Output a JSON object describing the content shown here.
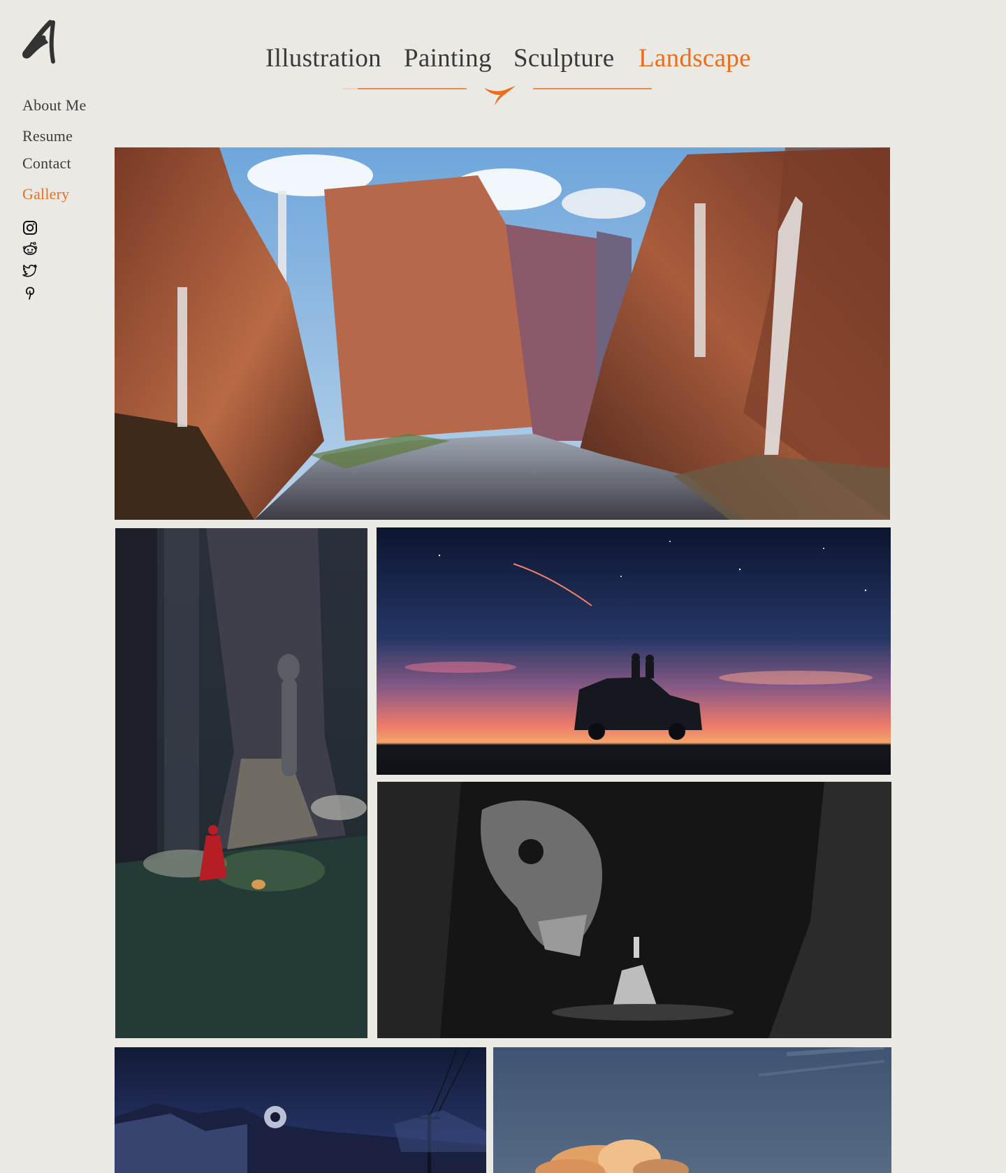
{
  "brand": {
    "logo_icon": "brush-stroke-logo-icon",
    "accent_color": "#ee6d1b"
  },
  "sidebar": {
    "items": [
      {
        "label": "About Me",
        "active": false
      },
      {
        "label": "Resume",
        "active": false
      },
      {
        "label": "Contact",
        "active": false
      },
      {
        "label": "Gallery",
        "active": true
      }
    ],
    "social": [
      "instagram-icon",
      "reddit-icon",
      "twitter-icon",
      "pinterest-icon"
    ]
  },
  "categories": {
    "items": [
      {
        "label": "Illustration",
        "active": false
      },
      {
        "label": "Painting",
        "active": false
      },
      {
        "label": "Sculpture",
        "active": false
      },
      {
        "label": "Landscape",
        "active": true
      }
    ],
    "divider_icon": "brush-mark-divider-icon"
  },
  "gallery": {
    "tiles": [
      "canyon-waterfalls-painting",
      "forest-red-riding-hood-painting",
      "sunset-car-stargazing-painting",
      "giant-skull-cave-painting",
      "night-village-power-lines-painting",
      "sky-clouds-painting"
    ]
  }
}
